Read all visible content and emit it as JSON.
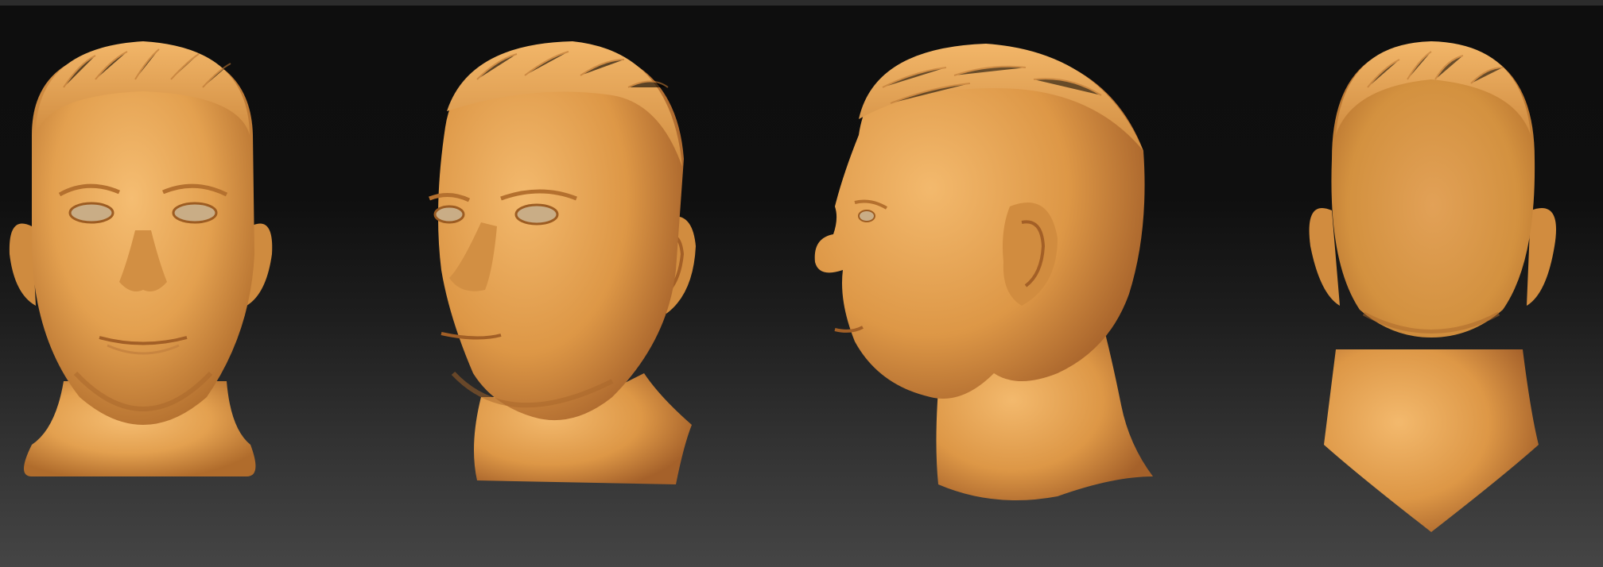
{
  "scene": {
    "background_colors": [
      "#0e0e0e",
      "#454545"
    ],
    "material_color": "#e4a04f",
    "material_shadow": "#a8662a",
    "material_highlight": "#f7c27a"
  },
  "views": [
    {
      "id": "front",
      "icon": "head-front-view"
    },
    {
      "id": "three-quarter",
      "icon": "head-three-quarter-view"
    },
    {
      "id": "profile",
      "icon": "head-profile-view"
    },
    {
      "id": "back",
      "icon": "head-back-view"
    }
  ]
}
